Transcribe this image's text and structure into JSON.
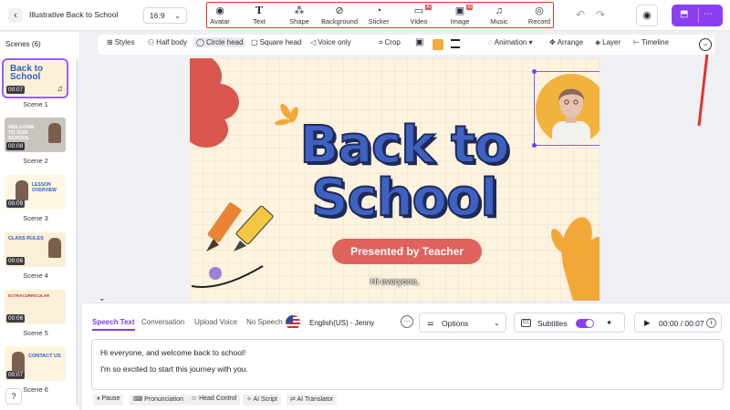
{
  "header": {
    "back_icon": "chevron-left-icon",
    "project_title": "Illustrative Back to School",
    "aspect_ratio": "16:9",
    "tools": [
      {
        "label": "Avatar",
        "icon": "avatar-icon",
        "ai": false
      },
      {
        "label": "Text",
        "icon": "text-icon",
        "ai": false
      },
      {
        "label": "Shape",
        "icon": "shape-icon",
        "ai": false
      },
      {
        "label": "Background",
        "icon": "background-icon",
        "ai": false
      },
      {
        "label": "Sticker",
        "icon": "sticker-icon",
        "ai": false
      },
      {
        "label": "Video",
        "icon": "video-icon",
        "ai": true
      },
      {
        "label": "Image",
        "icon": "image-icon",
        "ai": true
      },
      {
        "label": "Music",
        "icon": "music-icon",
        "ai": false
      },
      {
        "label": "Record",
        "icon": "record-icon",
        "ai": false
      }
    ],
    "ai_badge": "AI",
    "accent_color": "#8b3ff2",
    "highlight_color": "#e4312b"
  },
  "sidebar": {
    "title": "Scenes (6)",
    "scenes": [
      {
        "label": "Scene 1",
        "duration": "00:07",
        "thumb_text": "Back to School",
        "selected": true
      },
      {
        "label": "Scene 2",
        "duration": "00:08",
        "thumb_text": "WELCOME TO OUR SCHOOL",
        "selected": false
      },
      {
        "label": "Scene 3",
        "duration": "00:09",
        "thumb_text": "LESSON OVERVIEW",
        "selected": false
      },
      {
        "label": "Scene 4",
        "duration": "00:06",
        "thumb_text": "CLASS RULES",
        "selected": false
      },
      {
        "label": "Scene 5",
        "duration": "00:06",
        "thumb_text": "EXTRACURRICULAR",
        "selected": false
      },
      {
        "label": "Scene 6",
        "duration": "00:07",
        "thumb_text": "CONTACT US",
        "selected": false
      }
    ]
  },
  "subtoolbar": {
    "styles": "Styles",
    "half_body": "Half body",
    "circle_head": "Circle head",
    "square_head": "Square head",
    "voice_only": "Voice only",
    "crop": "Crop",
    "animation": "Animation",
    "arrange": "Arrange",
    "layer": "Layer",
    "timeline": "Timeline",
    "swatch_color": "#f4a93b"
  },
  "canvas": {
    "headline_1": "Back to",
    "headline_2": "School",
    "presenter": "Presented by Teacher",
    "caption": "Hi everyone,"
  },
  "panel": {
    "tabs": [
      "Speech Text",
      "Conversation",
      "Upload Voice",
      "No Speech"
    ],
    "voice": "English(US) - Jenny",
    "options": "Options",
    "subtitles": "Subtitles",
    "cc": "CC",
    "time": "00:00 / 00:07",
    "script_line_1": "Hi everyone, and welcome back to school!",
    "script_line_2": "I'm so excited to start this journey with you.",
    "chips": [
      "Pause",
      "Pronunciation",
      "Head Control",
      "AI Script",
      "AI Translator"
    ]
  }
}
